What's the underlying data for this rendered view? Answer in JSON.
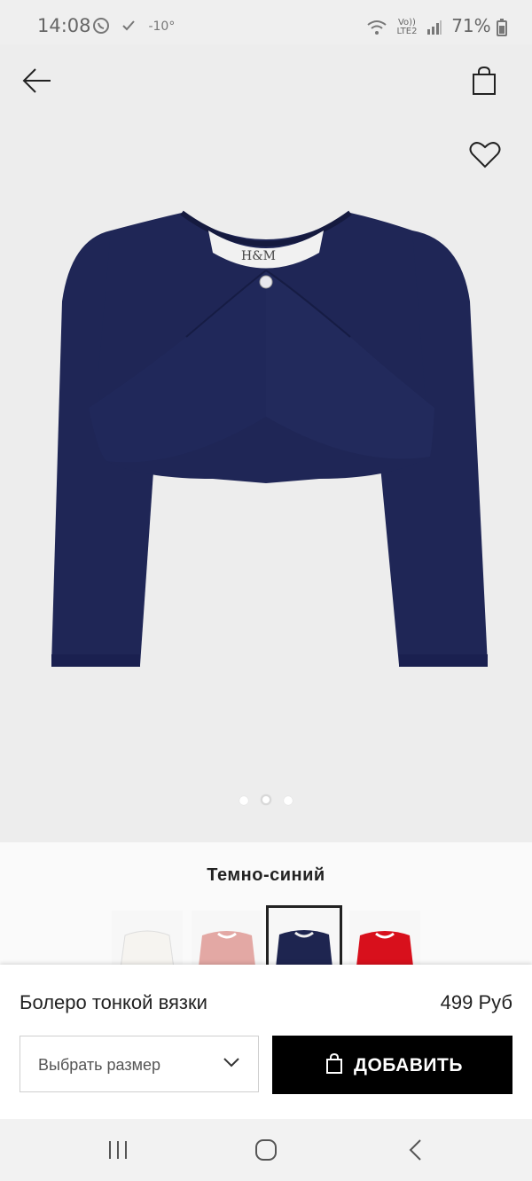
{
  "status_bar": {
    "time": "14:08",
    "temperature": "-10°",
    "network_top": "Vo))",
    "network_bottom": "LTE2",
    "battery": "71%"
  },
  "product_image": {
    "label_brand": "H&M",
    "page_indicator": {
      "count": 3,
      "active_index": 1
    }
  },
  "color_selector": {
    "selected_color_name": "Темно-синий",
    "swatches": [
      {
        "name": "white",
        "color": "#f6f4f0"
      },
      {
        "name": "pink",
        "color": "#e3a8a4"
      },
      {
        "name": "navy",
        "color": "#1e2550"
      },
      {
        "name": "red",
        "color": "#d8101c"
      }
    ]
  },
  "product": {
    "name": "Болеро тонкой вязки",
    "price": "499 Руб"
  },
  "size_select": {
    "placeholder": "Выбрать размер"
  },
  "add_button": {
    "label": "ДОБАВИТЬ"
  },
  "colors": {
    "garment": "#1f2656",
    "button": "#000000"
  }
}
